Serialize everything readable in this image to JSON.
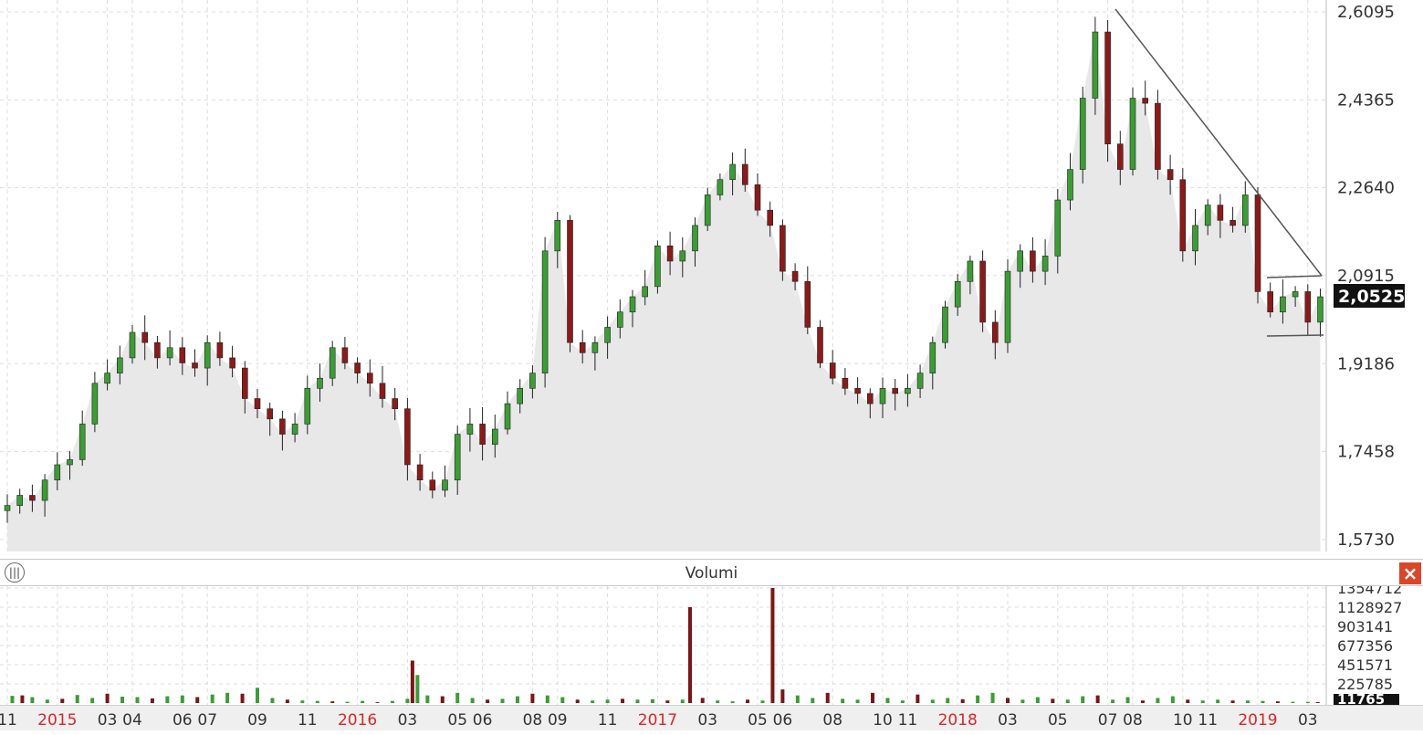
{
  "price_axis": {
    "ticks": [
      "2,6095",
      "2,4365",
      "2,2640",
      "2,0915",
      "1,9186",
      "1,7458",
      "1,5730"
    ],
    "last_price": "2,0525"
  },
  "volume_panel": {
    "title": "Volumi",
    "ticks": [
      "1354712",
      "1128927",
      "903141",
      "677356",
      "451571",
      "225785"
    ],
    "last_volume": "11765"
  },
  "time_axis": {
    "labels": [
      {
        "t": "11",
        "year": false,
        "x": 0
      },
      {
        "t": "2015",
        "year": true,
        "x": 2
      },
      {
        "t": "03",
        "year": false,
        "x": 4
      },
      {
        "t": "04",
        "year": false,
        "x": 5
      },
      {
        "t": "06",
        "year": false,
        "x": 7
      },
      {
        "t": "07",
        "year": false,
        "x": 8
      },
      {
        "t": "09",
        "year": false,
        "x": 10
      },
      {
        "t": "11",
        "year": false,
        "x": 12
      },
      {
        "t": "2016",
        "year": true,
        "x": 14
      },
      {
        "t": "03",
        "year": false,
        "x": 16
      },
      {
        "t": "05",
        "year": false,
        "x": 18
      },
      {
        "t": "06",
        "year": false,
        "x": 19
      },
      {
        "t": "08",
        "year": false,
        "x": 21
      },
      {
        "t": "09",
        "year": false,
        "x": 22
      },
      {
        "t": "11",
        "year": false,
        "x": 24
      },
      {
        "t": "2017",
        "year": true,
        "x": 26
      },
      {
        "t": "03",
        "year": false,
        "x": 28
      },
      {
        "t": "05",
        "year": false,
        "x": 30
      },
      {
        "t": "06",
        "year": false,
        "x": 31
      },
      {
        "t": "08",
        "year": false,
        "x": 33
      },
      {
        "t": "10",
        "year": false,
        "x": 35
      },
      {
        "t": "11",
        "year": false,
        "x": 36
      },
      {
        "t": "2018",
        "year": true,
        "x": 38
      },
      {
        "t": "03",
        "year": false,
        "x": 40
      },
      {
        "t": "05",
        "year": false,
        "x": 42
      },
      {
        "t": "07",
        "year": false,
        "x": 44
      },
      {
        "t": "08",
        "year": false,
        "x": 45
      },
      {
        "t": "10",
        "year": false,
        "x": 47
      },
      {
        "t": "11",
        "year": false,
        "x": 48
      },
      {
        "t": "2019",
        "year": true,
        "x": 50
      },
      {
        "t": "03",
        "year": false,
        "x": 52
      }
    ]
  },
  "chart_data": [
    {
      "type": "candlestick",
      "x_unit": "months since Nov 2014",
      "ylim": [
        1.573,
        2.6095
      ],
      "grid": true,
      "closes": [
        [
          0.0,
          1.64
        ],
        [
          0.5,
          1.66
        ],
        [
          1.0,
          1.65
        ],
        [
          1.5,
          1.69
        ],
        [
          2.0,
          1.72
        ],
        [
          2.5,
          1.73
        ],
        [
          3.0,
          1.8
        ],
        [
          3.5,
          1.88
        ],
        [
          4.0,
          1.9
        ],
        [
          4.5,
          1.93
        ],
        [
          5.0,
          1.98
        ],
        [
          5.5,
          1.96
        ],
        [
          6.0,
          1.93
        ],
        [
          6.5,
          1.95
        ],
        [
          7.0,
          1.92
        ],
        [
          7.5,
          1.91
        ],
        [
          8.0,
          1.96
        ],
        [
          8.5,
          1.93
        ],
        [
          9.0,
          1.91
        ],
        [
          9.5,
          1.85
        ],
        [
          10.0,
          1.83
        ],
        [
          10.5,
          1.81
        ],
        [
          11.0,
          1.78
        ],
        [
          11.5,
          1.8
        ],
        [
          12.0,
          1.87
        ],
        [
          12.5,
          1.89
        ],
        [
          13.0,
          1.95
        ],
        [
          13.5,
          1.92
        ],
        [
          14.0,
          1.9
        ],
        [
          14.5,
          1.88
        ],
        [
          15.0,
          1.85
        ],
        [
          15.5,
          1.83
        ],
        [
          16.0,
          1.72
        ],
        [
          16.5,
          1.69
        ],
        [
          17.0,
          1.67
        ],
        [
          17.5,
          1.69
        ],
        [
          18.0,
          1.78
        ],
        [
          18.5,
          1.8
        ],
        [
          19.0,
          1.76
        ],
        [
          19.5,
          1.79
        ],
        [
          20.0,
          1.84
        ],
        [
          20.5,
          1.87
        ],
        [
          21.0,
          1.9
        ],
        [
          21.5,
          2.14
        ],
        [
          22.0,
          2.2
        ],
        [
          22.5,
          1.96
        ],
        [
          23.0,
          1.94
        ],
        [
          23.5,
          1.96
        ],
        [
          24.0,
          1.99
        ],
        [
          24.5,
          2.02
        ],
        [
          25.0,
          2.05
        ],
        [
          25.5,
          2.07
        ],
        [
          26.0,
          2.15
        ],
        [
          26.5,
          2.12
        ],
        [
          27.0,
          2.14
        ],
        [
          27.5,
          2.19
        ],
        [
          28.0,
          2.25
        ],
        [
          28.5,
          2.28
        ],
        [
          29.0,
          2.31
        ],
        [
          29.5,
          2.27
        ],
        [
          30.0,
          2.22
        ],
        [
          30.5,
          2.19
        ],
        [
          31.0,
          2.1
        ],
        [
          31.5,
          2.08
        ],
        [
          32.0,
          1.99
        ],
        [
          32.5,
          1.92
        ],
        [
          33.0,
          1.89
        ],
        [
          33.5,
          1.87
        ],
        [
          34.0,
          1.86
        ],
        [
          34.5,
          1.84
        ],
        [
          35.0,
          1.87
        ],
        [
          35.5,
          1.86
        ],
        [
          36.0,
          1.87
        ],
        [
          36.5,
          1.9
        ],
        [
          37.0,
          1.96
        ],
        [
          37.5,
          2.03
        ],
        [
          38.0,
          2.08
        ],
        [
          38.5,
          2.12
        ],
        [
          39.0,
          2.0
        ],
        [
          39.5,
          1.96
        ],
        [
          40.0,
          2.1
        ],
        [
          40.5,
          2.14
        ],
        [
          41.0,
          2.1
        ],
        [
          41.5,
          2.13
        ],
        [
          42.0,
          2.24
        ],
        [
          42.5,
          2.3
        ],
        [
          43.0,
          2.44
        ],
        [
          43.5,
          2.57
        ],
        [
          44.0,
          2.35
        ],
        [
          44.5,
          2.3
        ],
        [
          45.0,
          2.44
        ],
        [
          45.5,
          2.43
        ],
        [
          46.0,
          2.3
        ],
        [
          46.5,
          2.28
        ],
        [
          47.0,
          2.14
        ],
        [
          47.5,
          2.19
        ],
        [
          48.0,
          2.23
        ],
        [
          48.5,
          2.2
        ],
        [
          49.0,
          2.19
        ],
        [
          49.5,
          2.25
        ],
        [
          50.0,
          2.06
        ],
        [
          50.5,
          2.02
        ],
        [
          51.0,
          2.05
        ],
        [
          51.5,
          2.06
        ],
        [
          52.0,
          2.0
        ],
        [
          52.5,
          2.05
        ]
      ]
    },
    {
      "type": "bar",
      "title": "Volumi",
      "ylim": [
        0,
        1354712
      ],
      "bars": [
        [
          0.2,
          85000
        ],
        [
          0.6,
          90000
        ],
        [
          1.0,
          70000
        ],
        [
          1.6,
          40000
        ],
        [
          2.2,
          50000
        ],
        [
          2.8,
          95000
        ],
        [
          3.4,
          60000
        ],
        [
          4.0,
          110000
        ],
        [
          4.6,
          75000
        ],
        [
          5.2,
          70000
        ],
        [
          5.8,
          55000
        ],
        [
          6.4,
          80000
        ],
        [
          7.0,
          90000
        ],
        [
          7.6,
          70000
        ],
        [
          8.2,
          100000
        ],
        [
          8.8,
          120000
        ],
        [
          9.4,
          110000
        ],
        [
          10.0,
          180000
        ],
        [
          10.6,
          60000
        ],
        [
          11.2,
          40000
        ],
        [
          11.8,
          30000
        ],
        [
          12.4,
          25000
        ],
        [
          13.0,
          20000
        ],
        [
          13.6,
          15000
        ],
        [
          14.2,
          25000
        ],
        [
          14.8,
          10000
        ],
        [
          15.4,
          25000
        ],
        [
          16.0,
          50000
        ],
        [
          16.2,
          500000
        ],
        [
          16.4,
          330000
        ],
        [
          16.8,
          90000
        ],
        [
          17.4,
          80000
        ],
        [
          18.0,
          120000
        ],
        [
          18.6,
          60000
        ],
        [
          19.2,
          40000
        ],
        [
          19.8,
          50000
        ],
        [
          20.4,
          80000
        ],
        [
          21.0,
          110000
        ],
        [
          21.6,
          90000
        ],
        [
          22.2,
          70000
        ],
        [
          22.8,
          40000
        ],
        [
          23.4,
          30000
        ],
        [
          24.0,
          40000
        ],
        [
          24.6,
          50000
        ],
        [
          25.2,
          40000
        ],
        [
          25.8,
          45000
        ],
        [
          26.4,
          30000
        ],
        [
          27.0,
          40000
        ],
        [
          27.3,
          1130000
        ],
        [
          27.8,
          60000
        ],
        [
          28.4,
          30000
        ],
        [
          29.0,
          20000
        ],
        [
          29.6,
          40000
        ],
        [
          30.2,
          30000
        ],
        [
          30.6,
          1354712
        ],
        [
          31.0,
          160000
        ],
        [
          31.6,
          90000
        ],
        [
          32.2,
          60000
        ],
        [
          32.8,
          120000
        ],
        [
          33.4,
          50000
        ],
        [
          34.0,
          40000
        ],
        [
          34.6,
          120000
        ],
        [
          35.2,
          60000
        ],
        [
          35.8,
          30000
        ],
        [
          36.4,
          100000
        ],
        [
          37.0,
          40000
        ],
        [
          37.6,
          60000
        ],
        [
          38.2,
          45000
        ],
        [
          38.8,
          90000
        ],
        [
          39.4,
          120000
        ],
        [
          40.0,
          60000
        ],
        [
          40.6,
          40000
        ],
        [
          41.2,
          70000
        ],
        [
          41.8,
          50000
        ],
        [
          42.4,
          40000
        ],
        [
          43.0,
          80000
        ],
        [
          43.6,
          90000
        ],
        [
          44.2,
          40000
        ],
        [
          44.8,
          70000
        ],
        [
          45.4,
          30000
        ],
        [
          46.0,
          60000
        ],
        [
          46.6,
          80000
        ],
        [
          47.2,
          40000
        ],
        [
          47.8,
          30000
        ],
        [
          48.4,
          40000
        ],
        [
          49.0,
          30000
        ],
        [
          49.6,
          30000
        ],
        [
          50.2,
          25000
        ],
        [
          50.8,
          20000
        ],
        [
          51.4,
          15000
        ],
        [
          52.0,
          14000
        ],
        [
          52.4,
          11765
        ]
      ]
    }
  ]
}
